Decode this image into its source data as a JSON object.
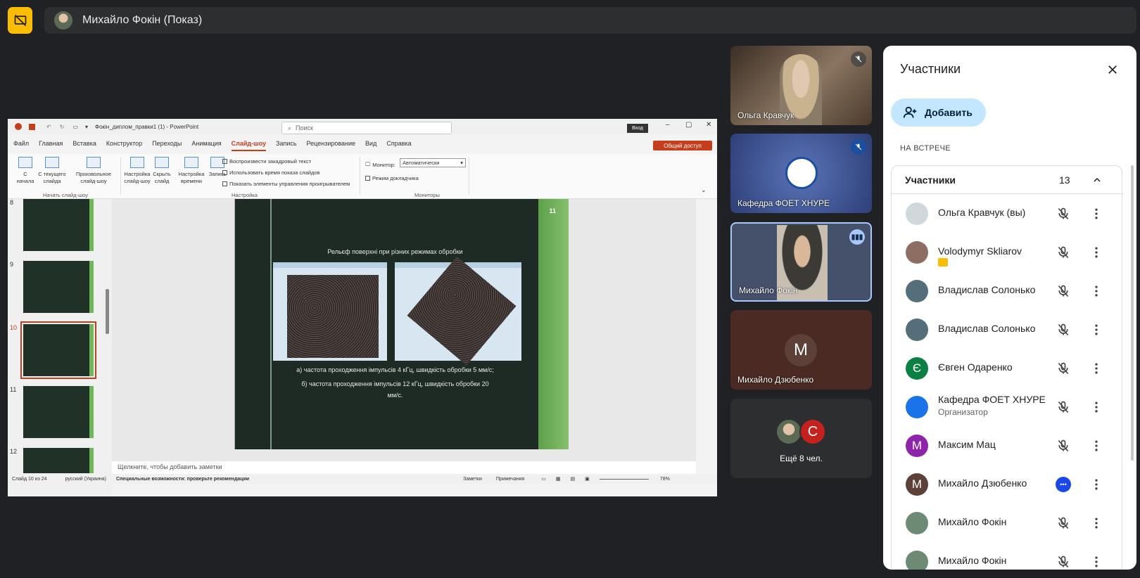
{
  "presenter": {
    "name": "Михайло Фокін (Показ)"
  },
  "ppt": {
    "title": "Фокін_диплом_правки1 (1) - PowerPoint",
    "search_placeholder": "Поиск",
    "login": "Вход",
    "tabs": [
      "Файл",
      "Главная",
      "Вставка",
      "Конструктор",
      "Переходы",
      "Анимация",
      "Слайд-шоу",
      "Запись",
      "Рецензирование",
      "Вид",
      "Справка"
    ],
    "active_tab": "Слайд-шоу",
    "share": "Общий доступ",
    "ribbon": {
      "from_start": "С начала",
      "from_current": "С текущего слайда",
      "custom": "Произвольное слайд-шоу",
      "group_start": "Начать слайд-шоу",
      "setup": "Настройка слайд-шоу",
      "hide": "Скрыть слайд",
      "timing": "Настройка времени",
      "record": "Запись",
      "chk1": "Воспроизвести закадровый текст",
      "chk2": "Использовать время показа слайдов",
      "chk3": "Показать элементы управления проигрывателем",
      "group_setup": "Настройка",
      "monitor_label": "Монитор:",
      "monitor_value": "Автоматически",
      "presenter_view": "Режим докладчика",
      "group_monitors": "Мониторы"
    },
    "thumb_numbers": [
      "8",
      "9",
      "10",
      "11",
      "12"
    ],
    "slide": {
      "number": "11",
      "title": "Рельєф поверхні при різних режимах обробки",
      "caption_a": "а) частота проходження імпульсів 4 кГц, швидкість обробки 5 мм/с;",
      "caption_b1": "б) частота проходження імпульсів 12 кГц, швидкість обробки 20",
      "caption_b2": "мм/с."
    },
    "notes": "Щелкните, чтобы добавить заметки",
    "status": {
      "slide": "Слайд 10 из 24",
      "lang": "русский (Украина)",
      "accessibility": "Специальные возможности: проверьте рекомендации",
      "notes_btn": "Заметки",
      "comments_btn": "Примечания",
      "zoom": "78%"
    }
  },
  "tiles": [
    {
      "name": "Ольга Кравчук"
    },
    {
      "name": "Кафедра ФОЕТ ХНУРЕ"
    },
    {
      "name": "Михайло Фокін"
    },
    {
      "name": "Михайло Дзюбенко",
      "initial": "M"
    },
    {
      "more": "Ещё 8 чел.",
      "initial": "C"
    }
  ],
  "panel": {
    "title": "Участники",
    "add": "Добавить",
    "section": "НА ВСТРЕЧЕ",
    "list_header": "Участники",
    "count": "13",
    "participants": [
      {
        "name": "Ольга Кравчук (вы)",
        "sub": "",
        "initial": "",
        "color": "#cfd8dc"
      },
      {
        "name": "Volodymyr Skliarov",
        "sub": "",
        "initial": "",
        "color": "#8d6e63"
      },
      {
        "name": "Владислав Солонько",
        "sub": "",
        "initial": "",
        "color": "#546e7a"
      },
      {
        "name": "Владислав Солонько",
        "sub": "",
        "initial": "",
        "color": "#546e7a"
      },
      {
        "name": "Євген Одаренко",
        "sub": "",
        "initial": "Є",
        "color": "#0b8043"
      },
      {
        "name": "Кафедра ФОЕТ ХНУРЕ",
        "sub": "Организатор",
        "initial": "",
        "color": "#1a73e8"
      },
      {
        "name": "Максим Мац",
        "sub": "",
        "initial": "M",
        "color": "#8e24aa"
      },
      {
        "name": "Михайло Дзюбенко",
        "sub": "",
        "initial": "M",
        "color": "#5d4037"
      },
      {
        "name": "Михайло Фокін",
        "sub": "",
        "initial": "",
        "color": "#6d8b74"
      },
      {
        "name": "Михайло Фокін",
        "sub": "",
        "initial": "",
        "color": "#6d8b74"
      }
    ]
  }
}
